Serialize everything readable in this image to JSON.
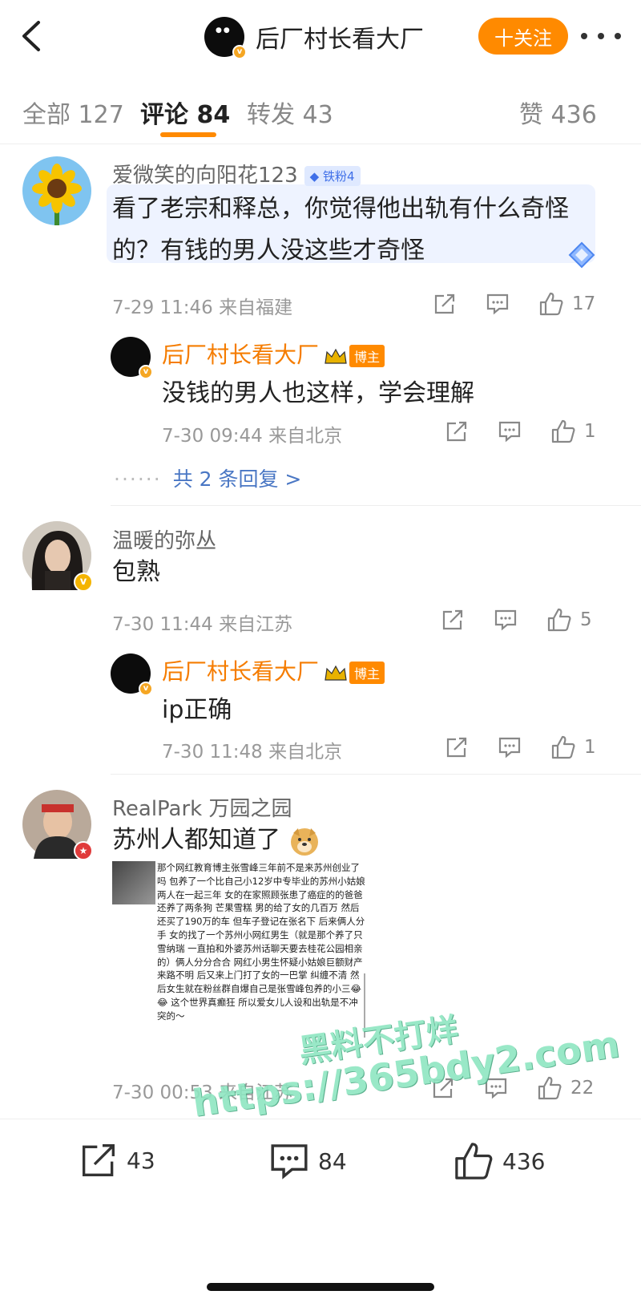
{
  "header": {
    "title": "后厂村长看大厂",
    "follow_label": "十关注"
  },
  "tabs": [
    {
      "label": "全部 127"
    },
    {
      "label": "评论 84"
    },
    {
      "label": "转发 43"
    },
    {
      "label": "赞 436"
    }
  ],
  "comments": [
    {
      "user": "爱微笑的向阳花123",
      "fan_badge": "铁粉4",
      "text_line1": "看了老宗和释总，你觉得他出轨有什么奇怪",
      "text_line2": "的？有钱的男人没这些才奇怪",
      "meta": "7-29 11:46  来自福建",
      "likes": "17",
      "reply": {
        "user": "后厂村长看大厂",
        "badge": "博主",
        "text": "没钱的男人也这样，学会理解",
        "meta": "7-30 09:44  来自北京",
        "likes": "1"
      },
      "more_replies": "共 2 条回复 >"
    },
    {
      "user": "温暖的弥丛",
      "text": "包熟",
      "meta": "7-30 11:44  来自江苏",
      "likes": "5",
      "reply": {
        "user": "后厂村长看大厂",
        "badge": "博主",
        "text": "ip正确",
        "meta": "7-30 11:48  来自北京",
        "likes": "1"
      }
    },
    {
      "user": "RealPark 万园之园",
      "text": "苏州人都知道了",
      "meta": "7-30 00:53  来自江苏",
      "likes": "22",
      "image_text": "那个网红教育博主张雪峰三年前不是来苏州创业了吗 包养了一个比自己小12岁中专毕业的苏州小姑娘 两人在一起三年 女的在家照顾张患了癌症的的爸爸 还养了两条狗 芒果雪糕 男的给了女的几百万 然后还买了190万的车 但车子登记在张名下 后来俩人分手 女的找了一个苏州小网红男生（就是那个养了只雪纳瑞 一直拍和外婆苏州话聊天要去桂花公园相亲的）俩人分分合合 网红小男生怀疑小姑娘巨额财产来路不明 后又来上门打了女的一巴掌 纠缠不清 然后女生就在粉丝群自爆自己是张雪峰包养的小三😂😂 这个世界真癫狂 所以爱女儿人设和出轨是不冲突的～"
    }
  ],
  "watermark": {
    "line1": "黑料不打烊",
    "line2": "https://365bdy2.com"
  },
  "bottom": {
    "share_count": "43",
    "comment_count": "84",
    "like_count": "436"
  },
  "colors": {
    "accent": "#ff8a00",
    "link": "#4a77c4"
  }
}
